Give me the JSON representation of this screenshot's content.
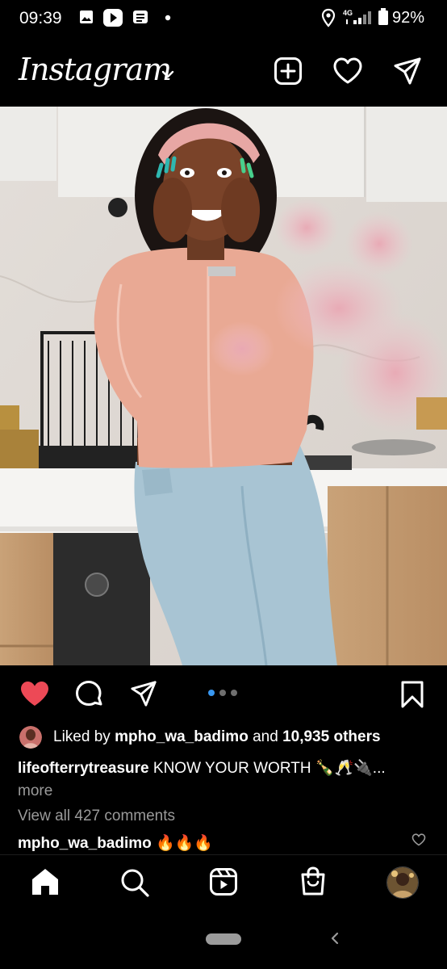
{
  "status_bar": {
    "time": "09:39",
    "network": "4G",
    "battery": "92%"
  },
  "header": {
    "app_title": "Instagram",
    "icons": [
      "new-post-icon",
      "activity-heart-icon",
      "direct-message-icon"
    ]
  },
  "post": {
    "liked": true,
    "carousel_dots": 3,
    "carousel_active_index": 0,
    "likes": {
      "prefix": "Liked by",
      "user": "mpho_wa_badimo",
      "joiner": "and",
      "count_text": "10,935 others"
    },
    "caption": {
      "username": "lifeofterrytreasure",
      "text": "KNOW YOUR WORTH 🍾🥂🔌...",
      "more": "more"
    },
    "view_comments": "View all 427 comments",
    "first_comment": {
      "username": "mpho_wa_badimo",
      "text": "🔥🔥🔥"
    }
  },
  "bottom_nav": {
    "items": [
      "home-icon",
      "search-icon",
      "reels-icon",
      "shop-icon",
      "profile-avatar"
    ]
  },
  "colors": {
    "background": "#000000",
    "like_red": "#ed4956",
    "accent_blue": "#3897f0",
    "muted_text": "#9a9a9a"
  }
}
